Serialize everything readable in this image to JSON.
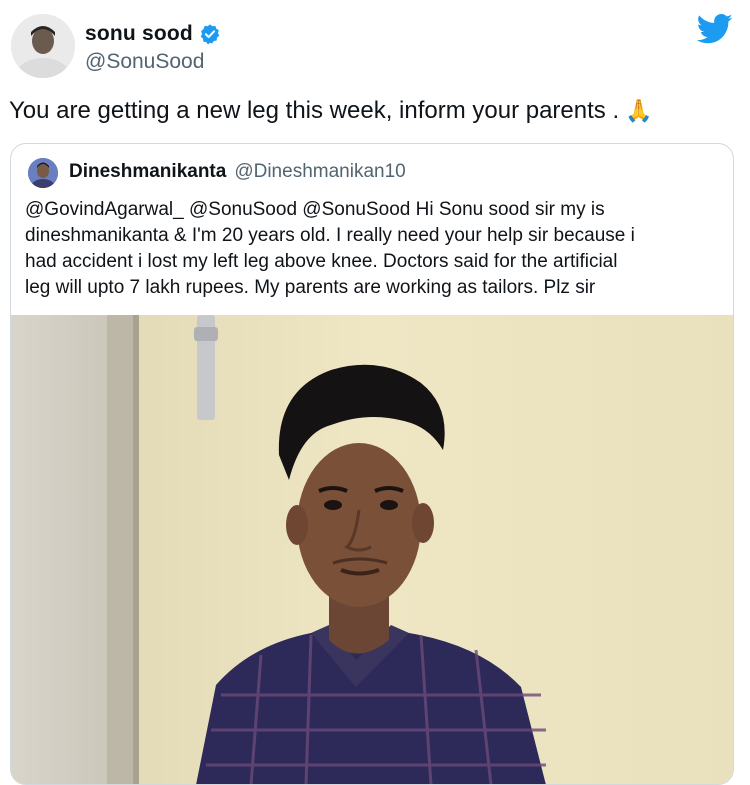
{
  "tweet": {
    "author_name": "sonu sood",
    "author_handle": "@SonuSood",
    "text": "You are getting a new leg this week, inform your parents .",
    "emoji": "🙏"
  },
  "quoted": {
    "author_name": "Dineshmanikanta",
    "author_handle": "@Dineshmanikan10",
    "text_lines": [
      "@GovindAgarwal_ @SonuSood @SonuSood Hi Sonu sood sir my is",
      "dineshmanikanta & I'm 20 years old. I really need your help sir because i",
      "had accident i lost my left leg above knee. Doctors said for the artificial",
      "leg will upto 7 lakh rupees. My parents are working as tailors. Plz sir"
    ]
  },
  "icons": {
    "verified": "verified-badge-icon",
    "brand": "twitter-bird-icon"
  },
  "colors": {
    "twitter_blue": "#1d9bf0",
    "handle_gray": "#536471",
    "text": "#0f1419",
    "border": "#cfd9de",
    "wall": "#ece4c0"
  }
}
